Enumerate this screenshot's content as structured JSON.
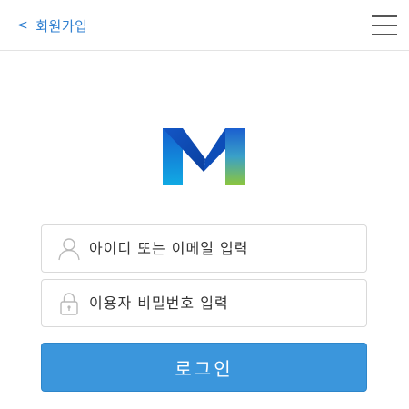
{
  "header": {
    "back_chevron": "<",
    "back_label": "회원가입",
    "menu_icon": "hamburger-menu-icon"
  },
  "logo": {
    "letter": "M",
    "colors": [
      "#1e6fd9",
      "#14a7e0",
      "#7ec242"
    ]
  },
  "form": {
    "id_placeholder": "아이디 또는 이메일 입력",
    "password_placeholder": "이용자 비밀번호 입력",
    "login_label": "로그인",
    "id_icon": "user-icon",
    "password_icon": "lock-icon"
  },
  "colors": {
    "accent": "#3b96dc",
    "link": "#2f7fd0"
  }
}
